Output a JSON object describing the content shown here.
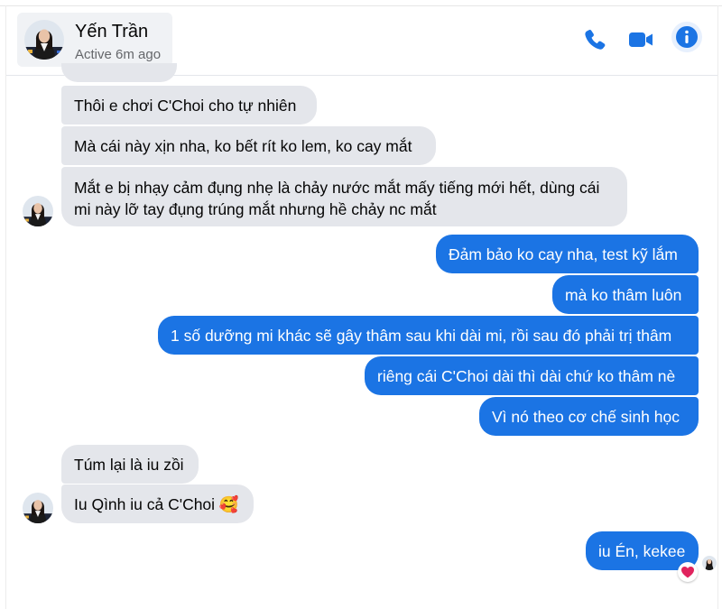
{
  "header": {
    "contact_name": "Yến Trần",
    "status": "Active 6m ago",
    "icons": [
      "phone-icon",
      "video-camera-icon",
      "info-icon"
    ]
  },
  "colors": {
    "accent": "#1b74e4",
    "incoming_bubble": "#e4e6eb",
    "reaction": "#e0245e"
  },
  "messages": [
    {
      "from": "contact",
      "text": "Thôi e chơi C'Choi cho tự nhiên"
    },
    {
      "from": "contact",
      "text": "Mà cái này xịn nha, ko bết rít ko lem, ko cay mắt"
    },
    {
      "from": "contact",
      "text": "Mắt e bị nhạy cảm đụng nhẹ là chảy nước mắt mấy tiếng mới hết, dùng cái mi này lỡ tay đụng trúng mắt nhưng hề chảy nc mắt"
    },
    {
      "from": "me",
      "text": "Đảm bảo ko cay nha, test kỹ lắm"
    },
    {
      "from": "me",
      "text": "mà ko thâm luôn"
    },
    {
      "from": "me",
      "text": "1 số dưỡng mi khác sẽ gây thâm sau khi dài mi, rồi sau đó phải trị thâm"
    },
    {
      "from": "me",
      "text": "riêng cái C'Choi dài thì dài chứ ko thâm nè"
    },
    {
      "from": "me",
      "text": "Vì nó theo cơ chế sinh học"
    },
    {
      "from": "contact",
      "text": "Túm lại là iu zồi"
    },
    {
      "from": "contact",
      "text": "Iu Qình iu cả C'Choi 🥰"
    },
    {
      "from": "me",
      "text": "iu Én, kekee",
      "reaction": "heart"
    }
  ]
}
